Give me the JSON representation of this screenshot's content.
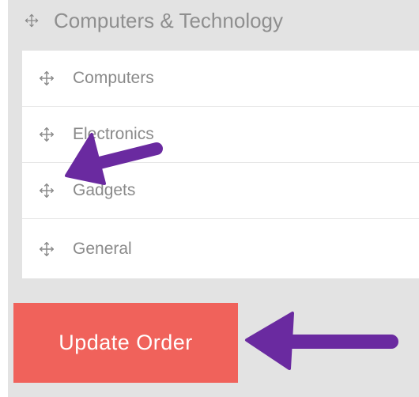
{
  "category": {
    "title": "Computers & Technology",
    "icon": "move-icon"
  },
  "subcategories": [
    {
      "label": "Computers",
      "icon": "move-icon"
    },
    {
      "label": "Electronics",
      "icon": "move-icon"
    },
    {
      "label": "Gadgets",
      "icon": "move-icon"
    },
    {
      "label": "General",
      "icon": "move-icon"
    }
  ],
  "actions": {
    "update_order_label": "Update Order"
  },
  "colors": {
    "button": "#f0625b",
    "annotation_arrow": "#6a2aa0",
    "panel_background": "#e3e3e3"
  }
}
